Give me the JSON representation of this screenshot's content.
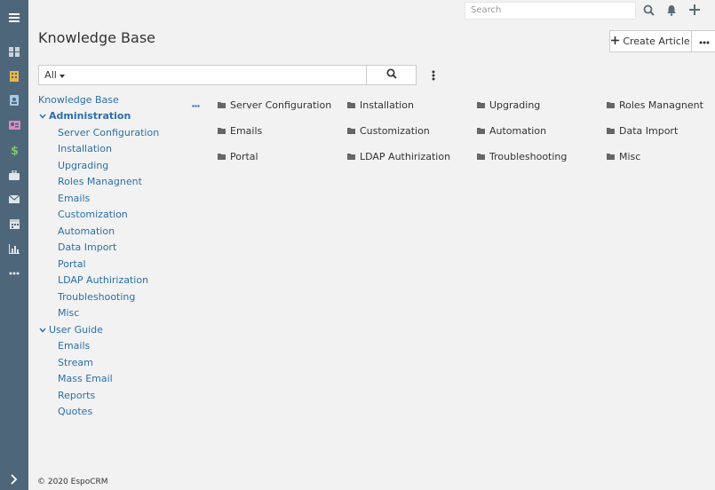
{
  "header": {
    "search_placeholder": "Search"
  },
  "page": {
    "title": "Knowledge Base",
    "create_button_label": "Create Article",
    "filter_label": "All"
  },
  "tree": {
    "root_label": "Knowledge Base",
    "categories": [
      {
        "label": "Administration",
        "bold": true,
        "items": [
          "Server Configuration",
          "Installation",
          "Upgrading",
          "Roles Managnent",
          "Emails",
          "Customization",
          "Automation",
          "Data Import",
          "Portal",
          "LDAP Authirization",
          "Troubleshooting",
          "Misc"
        ]
      },
      {
        "label": "User Guide",
        "bold": false,
        "items": [
          "Emails",
          "Stream",
          "Mass Email",
          "Reports",
          "Quotes"
        ]
      }
    ]
  },
  "folders": [
    [
      "Server Configuration",
      "Installation",
      "Upgrading",
      "Roles Managnent"
    ],
    [
      "Emails",
      "Customization",
      "Automation",
      "Data Import"
    ],
    [
      "Portal",
      "LDAP Authirization",
      "Troubleshooting",
      "Misc"
    ]
  ],
  "sidebar_icons": [
    "menu-icon",
    "dashboard-icon",
    "accounts-icon",
    "contacts-icon",
    "leads-icon",
    "opportunities-icon",
    "cases-icon",
    "emails-icon",
    "calendar-icon",
    "reports-icon",
    "more-icon"
  ],
  "colors": {
    "sidebar": "#4e6679",
    "link": "#2c6fa8",
    "background": "#f2f2f2"
  },
  "footer": {
    "copyright": "© 2020 EspoCRM"
  }
}
